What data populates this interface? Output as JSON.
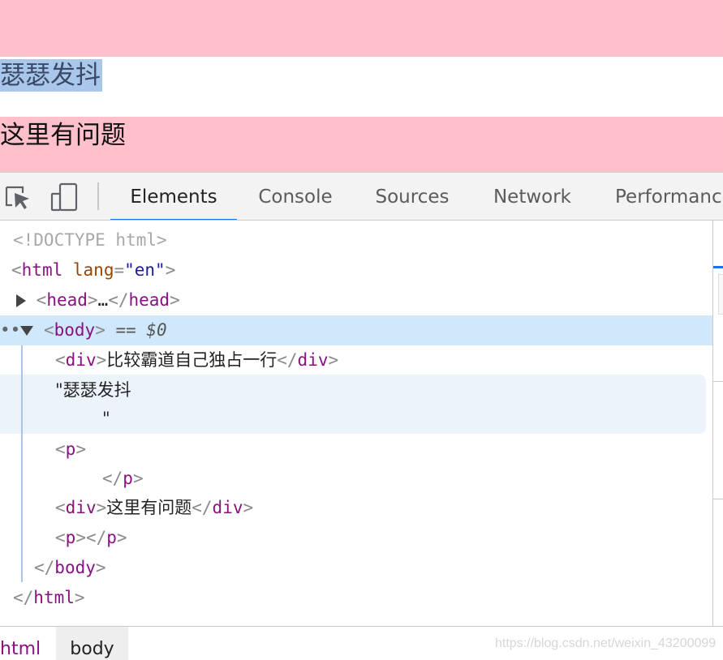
{
  "page": {
    "text_node": "瑟瑟发抖",
    "div_text": "这里有问题"
  },
  "devtools": {
    "icons": {
      "inspect": "inspect-element-icon",
      "device": "device-toolbar-icon"
    },
    "tabs": [
      {
        "label": "Elements",
        "active": true
      },
      {
        "label": "Console",
        "active": false
      },
      {
        "label": "Sources",
        "active": false
      },
      {
        "label": "Network",
        "active": false
      },
      {
        "label": "Performance",
        "active": false
      }
    ],
    "dom": {
      "doctype": "<!DOCTYPE html>",
      "html_lt": "<",
      "html_tag": "html",
      "attr_name": "lang",
      "attr_eq": "=",
      "attr_value": "\"en\"",
      "gt": ">",
      "head_open": "head",
      "ellipsis": "…",
      "close_prefix": "</",
      "head_close": "head",
      "body_tag": "body",
      "selected_marker": " == $0",
      "ellipsis_dots": "••",
      "div_tag": "div",
      "div1_text": "比较霸道自己独占一行",
      "text_node_line1": "\"瑟瑟发抖",
      "text_node_line2": "\"",
      "p_tag": "p",
      "div2_text": "这里有问题"
    },
    "breadcrumbs": [
      "html",
      "body"
    ],
    "watermark": "https://blog.csdn.net/weixin_43200099"
  },
  "colors": {
    "pink": "#ffc0cb",
    "selection": "#a9c7eb",
    "tab_active_underline": "#1a73e8",
    "tag": "#881280",
    "attr": "#994500",
    "attr_value": "#1a1aa6",
    "selected_row": "#cfe8fc"
  }
}
